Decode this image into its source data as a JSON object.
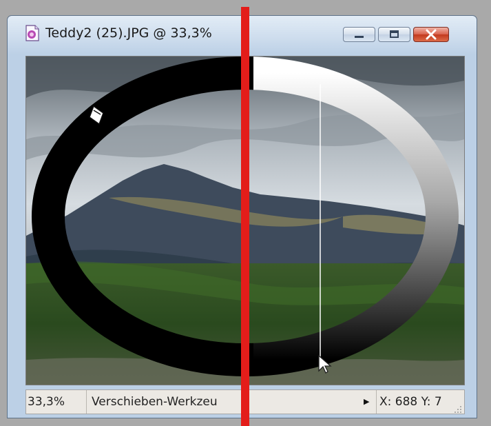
{
  "window": {
    "title": "Teddy2 (25).JPG @ 33,3%",
    "icon": "image-file-icon",
    "buttons": [
      "minimize-icon",
      "maximize-icon",
      "close-icon"
    ]
  },
  "canvas": {
    "overlay": "elliptical-gradient-ring",
    "cursor": "arrow-cursor-icon",
    "tool_cursor": "gradient-tool-icon"
  },
  "status": {
    "zoom": "33,3%",
    "tool": "Verschieben-Werkzeu",
    "coords": "X: 688  Y: 7"
  },
  "colors": {
    "titlebar": "#cfdeee",
    "close_button": "#c2391f",
    "annotation_line": "#e31d1a",
    "statusbar": "#ece9e4"
  }
}
